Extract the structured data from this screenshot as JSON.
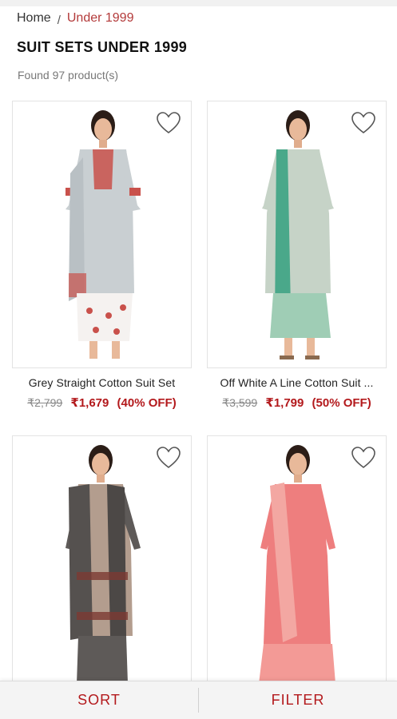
{
  "breadcrumb": {
    "home": "Home",
    "separator": "/",
    "current": "Under 1999"
  },
  "page_title": "SUIT SETS UNDER 1999",
  "result_count": "Found 97 product(s)",
  "products": [
    {
      "name": "Grey Straight Cotton Suit Set",
      "mrp": "₹2,799",
      "price": "₹1,679",
      "discount": "(40% OFF)"
    },
    {
      "name": "Off White A Line Cotton Suit ...",
      "mrp": "₹3,599",
      "price": "₹1,799",
      "discount": "(50% OFF)"
    },
    {
      "name": "",
      "mrp": "",
      "price": "",
      "discount": ""
    },
    {
      "name": "",
      "mrp": "",
      "price": "",
      "discount": ""
    }
  ],
  "bottom_bar": {
    "sort_label": "SORT",
    "filter_label": "FILTER"
  },
  "colors": {
    "accent": "#b3191c",
    "breadcrumb_active": "#b33a3a"
  },
  "icons": {
    "wishlist": "heart-outline-icon"
  }
}
